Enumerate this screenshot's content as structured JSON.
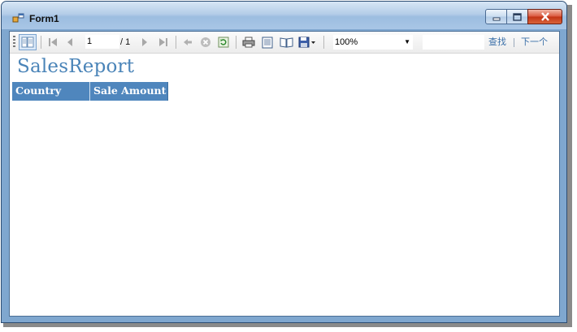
{
  "window": {
    "title": "Form1"
  },
  "toolbar": {
    "current_page": "1",
    "total_pages": "/ 1",
    "zoom": "100%",
    "find_label": "查找",
    "find_next_label": "下一个"
  },
  "report": {
    "title": "SalesReport",
    "columns": [
      "Country",
      "Sale Amount"
    ]
  },
  "colors": {
    "header_bg": "#4f86bd",
    "title_text": "#4a84b8",
    "close_button": "#c23214"
  }
}
